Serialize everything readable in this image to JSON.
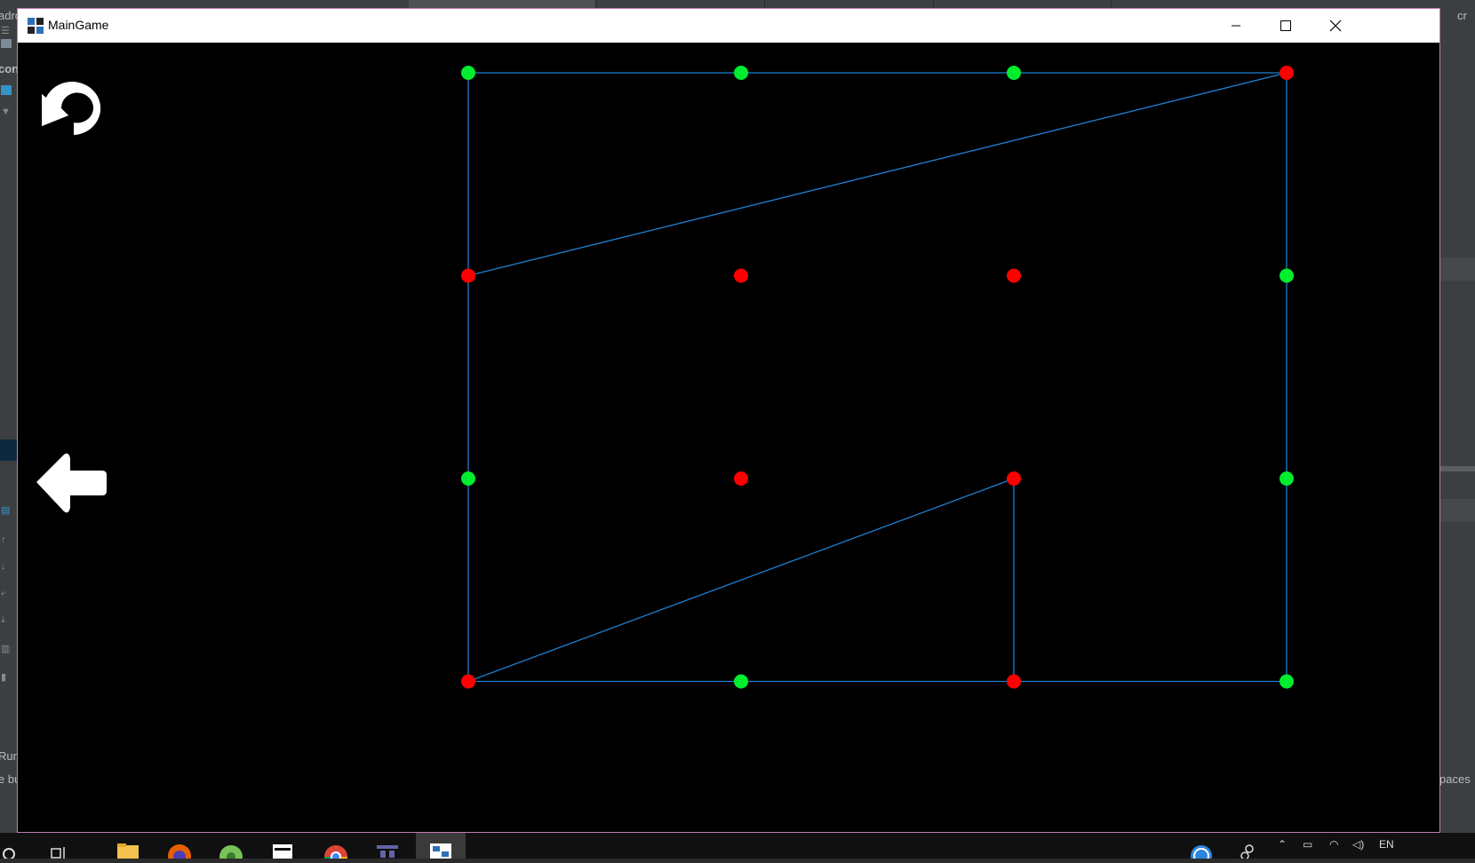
{
  "window": {
    "title": "MainGame",
    "controls": [
      "minimize",
      "maximize",
      "close"
    ]
  },
  "toolbar": {
    "undo_icon": "undo-icon",
    "back_icon": "back-arrow-icon"
  },
  "board": {
    "rows": 4,
    "cols": 4,
    "colors": {
      "on": "#00ee2e",
      "off": "#ff0000",
      "line": "#1f7fd1"
    },
    "points": [
      {
        "r": 0,
        "c": 0,
        "state": "on"
      },
      {
        "r": 0,
        "c": 1,
        "state": "on"
      },
      {
        "r": 0,
        "c": 2,
        "state": "on"
      },
      {
        "r": 0,
        "c": 3,
        "state": "off"
      },
      {
        "r": 1,
        "c": 0,
        "state": "off"
      },
      {
        "r": 1,
        "c": 1,
        "state": "off"
      },
      {
        "r": 1,
        "c": 2,
        "state": "off"
      },
      {
        "r": 1,
        "c": 3,
        "state": "on"
      },
      {
        "r": 2,
        "c": 0,
        "state": "on"
      },
      {
        "r": 2,
        "c": 1,
        "state": "off"
      },
      {
        "r": 2,
        "c": 2,
        "state": "off"
      },
      {
        "r": 2,
        "c": 3,
        "state": "on"
      },
      {
        "r": 3,
        "c": 0,
        "state": "off"
      },
      {
        "r": 3,
        "c": 1,
        "state": "on"
      },
      {
        "r": 3,
        "c": 2,
        "state": "off"
      },
      {
        "r": 3,
        "c": 3,
        "state": "on"
      }
    ],
    "edges": [
      [
        [
          0,
          0
        ],
        [
          0,
          3
        ]
      ],
      [
        [
          0,
          3
        ],
        [
          1,
          0
        ]
      ],
      [
        [
          0,
          3
        ],
        [
          3,
          3
        ]
      ],
      [
        [
          0,
          0
        ],
        [
          3,
          0
        ]
      ],
      [
        [
          3,
          0
        ],
        [
          3,
          3
        ]
      ],
      [
        [
          3,
          0
        ],
        [
          2,
          2
        ]
      ],
      [
        [
          2,
          2
        ],
        [
          3,
          2
        ]
      ]
    ]
  },
  "ide_fragments": {
    "left": [
      "adro",
      "con",
      "Run",
      "e bu"
    ],
    "right": [
      "cr",
      "paces"
    ],
    "badge": "c"
  },
  "taskbar": {
    "items": [
      "search-icon",
      "task-view-icon",
      "file-explorer-icon",
      "firefox-icon",
      "android-icon",
      "calculator-icon",
      "chrome-icon",
      "teams-icon",
      "maingame-icon"
    ],
    "tray_lang": "EN"
  }
}
